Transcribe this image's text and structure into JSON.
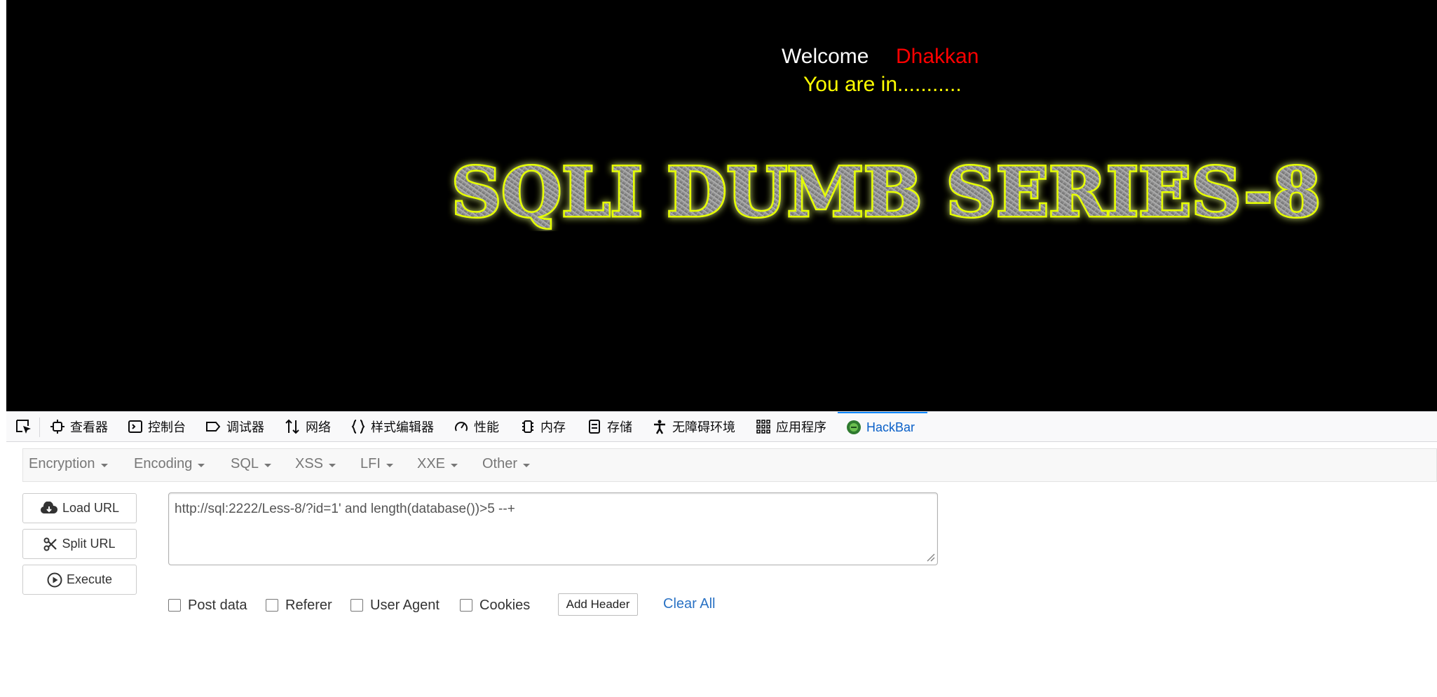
{
  "page": {
    "welcome_label": "Welcome",
    "user_name": "Dhakkan",
    "status_text": "You are in...........",
    "banner_text": "SQLI DUMB SERIES-8",
    "colors": {
      "background": "#000000",
      "welcome": "#ffffff",
      "user_name": "#ff0000",
      "status": "#ffff00",
      "banner_glow": "#e6ff00"
    }
  },
  "devtools": {
    "picker_icon": "element-picker-icon",
    "tabs": [
      {
        "label": "查看器",
        "icon": "inspector-icon"
      },
      {
        "label": "控制台",
        "icon": "console-icon"
      },
      {
        "label": "调试器",
        "icon": "debugger-icon"
      },
      {
        "label": "网络",
        "icon": "network-icon"
      },
      {
        "label": "样式编辑器",
        "icon": "style-editor-icon"
      },
      {
        "label": "性能",
        "icon": "performance-icon"
      },
      {
        "label": "内存",
        "icon": "memory-icon"
      },
      {
        "label": "存储",
        "icon": "storage-icon"
      },
      {
        "label": "无障碍环境",
        "icon": "accessibility-icon"
      },
      {
        "label": "应用程序",
        "icon": "application-icon"
      },
      {
        "label": "HackBar",
        "icon": "hackbar-icon",
        "active": true
      }
    ]
  },
  "hackbar": {
    "menus": [
      "Encryption",
      "Encoding",
      "SQL",
      "XSS",
      "LFI",
      "XXE",
      "Other"
    ],
    "buttons": {
      "load_url": "Load URL",
      "split_url": "Split URL",
      "execute": "Execute"
    },
    "url_value": "http://sql:2222/Less-8/?id=1' and length(database())>5 --+",
    "options": {
      "post_data": "Post data",
      "referer": "Referer",
      "user_agent": "User Agent",
      "cookies": "Cookies"
    },
    "add_header": "Add Header",
    "clear_all": "Clear All",
    "colors": {
      "link": "#2a72c4",
      "menu_text": "#777777"
    }
  }
}
